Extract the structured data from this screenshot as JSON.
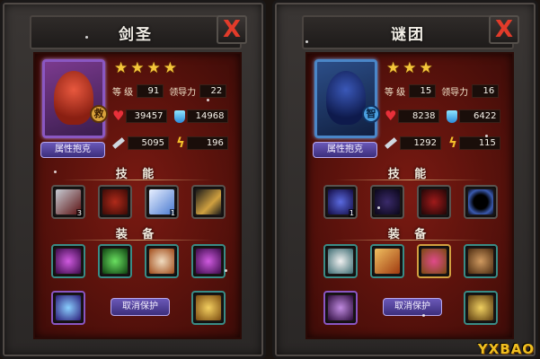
{
  "panels": [
    {
      "title": "剑圣",
      "close_label": "X",
      "stars": 4,
      "badge": "救",
      "attr_button": "属性抱克",
      "stats": {
        "level_label": "等 级",
        "level": "91",
        "lead_label": "领导力",
        "lead": "22",
        "hp": "39457",
        "mp": "14968",
        "attack": "5095",
        "speed": "196"
      },
      "skills_title": "技 能",
      "skills": [
        {
          "icon": "blade-skill-icon",
          "num": "3"
        },
        {
          "icon": "beast-skill-icon",
          "num": ""
        },
        {
          "icon": "slash-skill-icon",
          "num": "1"
        },
        {
          "icon": "dark-blade-skill-icon",
          "num": ""
        }
      ],
      "equip_title": "装 备",
      "equipment": [
        {
          "icon": "purple-boot-icon",
          "rarity": "teal"
        },
        {
          "icon": "green-gem-icon",
          "rarity": "teal"
        },
        {
          "icon": "drum-icon",
          "rarity": "teal"
        },
        {
          "icon": "purple-boot-icon",
          "rarity": "teal"
        }
      ],
      "bottom_left": "orb-icon",
      "unprotect_button": "取消保护",
      "bottom_right": "gold-helmet-icon"
    },
    {
      "title": "谜团",
      "close_label": "X",
      "stars": 3,
      "badge": "智",
      "attr_button": "属性抱克",
      "stats": {
        "level_label": "等 级",
        "level": "15",
        "lead_label": "领导力",
        "lead": "16",
        "hp": "8238",
        "mp": "6422",
        "attack": "1292",
        "speed": "115"
      },
      "skills_title": "技 能",
      "skills": [
        {
          "icon": "void-skill-icon",
          "num": "1"
        },
        {
          "icon": "shadow-skill-icon",
          "num": ""
        },
        {
          "icon": "claw-skill-icon",
          "num": ""
        },
        {
          "icon": "black-hole-skill-icon",
          "num": ""
        }
      ],
      "equip_title": "装 备",
      "equipment": [
        {
          "icon": "horseshoe-amulet-icon",
          "rarity": "teal"
        },
        {
          "icon": "sword-icon",
          "rarity": "teal"
        },
        {
          "icon": "shield-gem-icon",
          "rarity": "gold"
        },
        {
          "icon": "gear-shield-icon",
          "rarity": "teal"
        }
      ],
      "bottom_left": "purple-claw-icon",
      "unprotect_button": "取消保护",
      "bottom_right": "gold-belt-icon"
    }
  ],
  "watermark": "YXBAO",
  "colors": {
    "frame": "#2a2726",
    "content_bg": "#5a120c",
    "star": "#f4c63a",
    "close": "#e23b2a",
    "button": "#4c3c96"
  }
}
